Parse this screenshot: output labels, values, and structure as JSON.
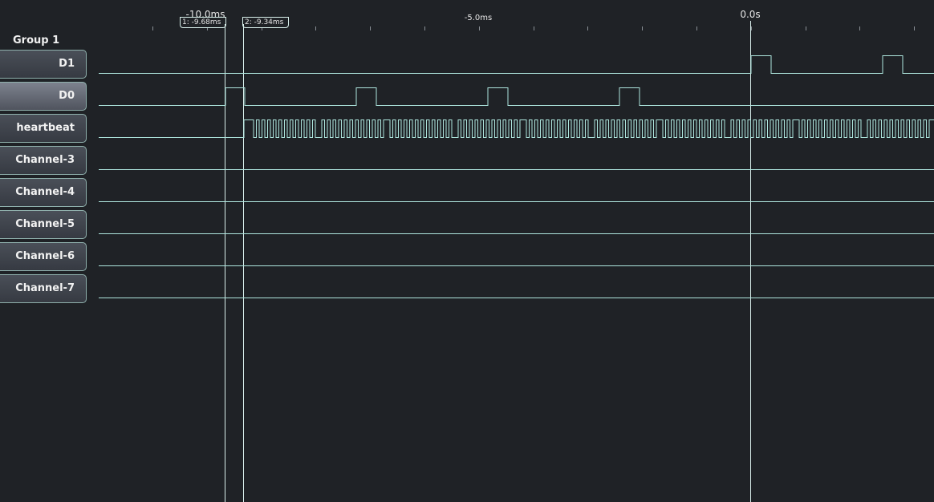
{
  "ruler": {
    "ticks": [
      {
        "label": "-10.0ms",
        "small": false
      },
      {
        "label": "-5.0ms",
        "small": true
      },
      {
        "label": "0.0s",
        "small": false
      }
    ]
  },
  "cursors": [
    {
      "label": "1: -9.68ms"
    },
    {
      "label": "2: -9.34ms"
    }
  ],
  "group": {
    "label": "Group 1"
  },
  "channels": [
    {
      "label": "D1",
      "selected": false
    },
    {
      "label": "D0",
      "selected": true
    },
    {
      "label": "heartbeat",
      "selected": false
    },
    {
      "label": "Channel-3",
      "selected": false
    },
    {
      "label": "Channel-4",
      "selected": false
    },
    {
      "label": "Channel-5",
      "selected": false
    },
    {
      "label": "Channel-6",
      "selected": false
    },
    {
      "label": "Channel-7",
      "selected": false
    }
  ],
  "colors": {
    "background": "#1f2226",
    "trace": "#aee6de",
    "cursor_line": "#d9f0ec"
  }
}
